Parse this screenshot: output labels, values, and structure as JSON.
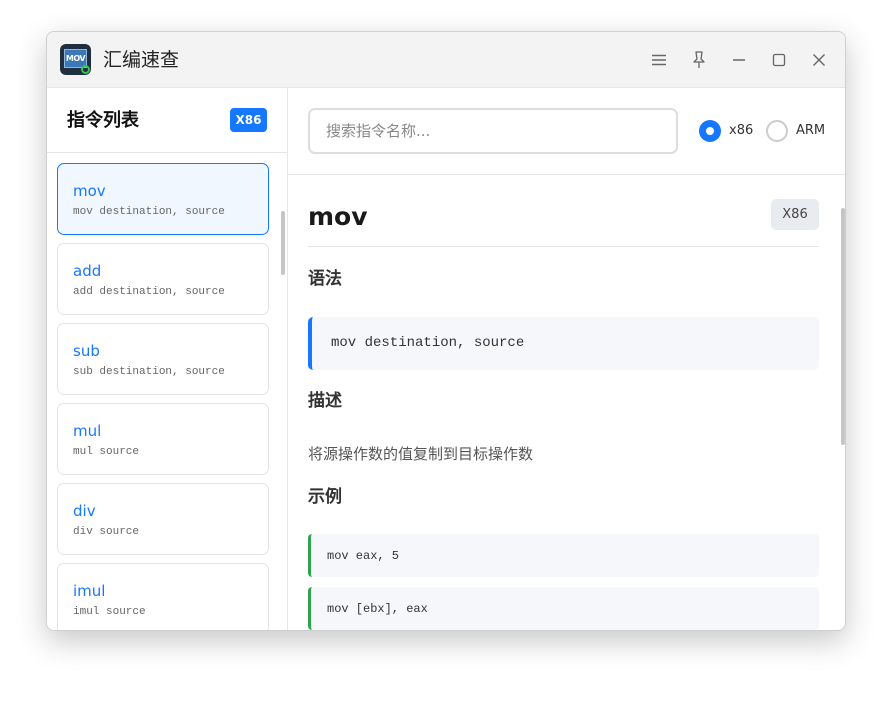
{
  "app": {
    "icon_text": "MOV",
    "title": "汇编速查"
  },
  "titlebar": {
    "buttons": [
      "menu-icon",
      "pin-icon",
      "minimize-icon",
      "maximize-icon",
      "close-icon"
    ]
  },
  "sidebar": {
    "title": "指令列表",
    "arch_badge": "X86",
    "items": [
      {
        "name": "mov",
        "syntax": "mov destination, source",
        "active": true
      },
      {
        "name": "add",
        "syntax": "add destination, source",
        "active": false
      },
      {
        "name": "sub",
        "syntax": "sub destination, source",
        "active": false
      },
      {
        "name": "mul",
        "syntax": "mul source",
        "active": false
      },
      {
        "name": "div",
        "syntax": "div source",
        "active": false
      },
      {
        "name": "imul",
        "syntax": "imul source",
        "active": false
      }
    ]
  },
  "search": {
    "placeholder": "搜索指令名称..."
  },
  "arch_options": [
    {
      "label": "x86",
      "checked": true
    },
    {
      "label": "ARM",
      "checked": false
    }
  ],
  "detail": {
    "name": "mov",
    "arch": "X86",
    "syntax_heading": "语法",
    "syntax": "mov destination, source",
    "description_heading": "描述",
    "description": "将源操作数的值复制到目标操作数",
    "examples_heading": "示例",
    "examples": [
      "mov eax, 5",
      "mov [ebx], eax"
    ]
  },
  "colors": {
    "accent": "#1677ff",
    "example_border": "#2ea44f",
    "active_bg": "#f0f7ff"
  }
}
